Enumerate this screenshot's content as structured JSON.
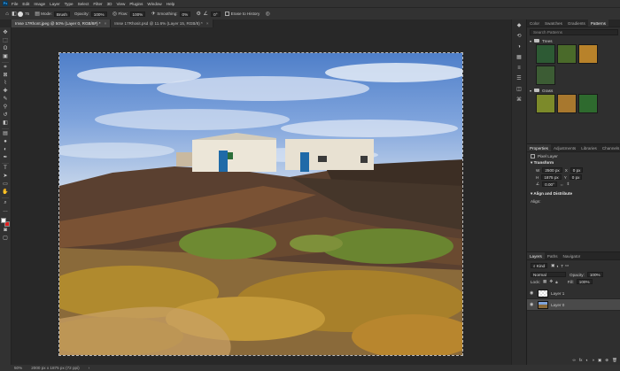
{
  "menubar": {
    "logo": "Ps",
    "items": [
      "File",
      "Edit",
      "Image",
      "Layer",
      "Type",
      "Select",
      "Filter",
      "3D",
      "View",
      "Plugins",
      "Window",
      "Help"
    ]
  },
  "options": {
    "mode_label": "Mode:",
    "mode_value": "Brush",
    "opacity_label": "Opacity:",
    "opacity_value": "100%",
    "flow_label": "Flow:",
    "flow_value": "100%",
    "smoothing_label": "Smoothing:",
    "smoothing_value": "0%",
    "angle_value": "0°",
    "erase_history": "Erase to History",
    "brush_size": "75"
  },
  "tabs": [
    {
      "label": "Imse 17Rhont.jpeg @ 50% (Layer 0, RGB/8#) *",
      "close": "×"
    },
    {
      "label": "Imse 17Rhosit.psd @ 11.6% (Layer 15, RGB/8) *",
      "close": "×"
    }
  ],
  "toolbar": {
    "tools": [
      {
        "name": "move-tool",
        "glyph": "✥"
      },
      {
        "name": "artboard-tool",
        "glyph": "⬚"
      },
      {
        "name": "lasso-tool",
        "glyph": "ʘ"
      },
      {
        "name": "object-select-tool",
        "glyph": "▣"
      },
      {
        "name": "crop-tool",
        "glyph": "⌗"
      },
      {
        "name": "frame-tool",
        "glyph": "⊠"
      },
      {
        "name": "eyedropper-tool",
        "glyph": "⌇"
      },
      {
        "name": "spot-healing-tool",
        "glyph": "✚"
      },
      {
        "name": "brush-tool",
        "glyph": "✎"
      },
      {
        "name": "clone-stamp-tool",
        "glyph": "⚲"
      },
      {
        "name": "history-brush-tool",
        "glyph": "↺"
      },
      {
        "name": "eraser-tool",
        "glyph": "◧"
      },
      {
        "name": "gradient-tool",
        "glyph": "▤"
      },
      {
        "name": "blur-tool",
        "glyph": "●"
      },
      {
        "name": "dodge-tool",
        "glyph": "◐"
      },
      {
        "name": "pen-tool",
        "glyph": "✒"
      },
      {
        "name": "type-tool",
        "glyph": "T"
      },
      {
        "name": "path-select-tool",
        "glyph": "➤"
      },
      {
        "name": "rectangle-tool",
        "glyph": "▭"
      },
      {
        "name": "hand-tool",
        "glyph": "✋"
      },
      {
        "name": "zoom-tool",
        "glyph": "⌕"
      },
      {
        "name": "more-tools",
        "glyph": "…"
      }
    ],
    "fg_color": "#ffffff",
    "bg_color": "#e01e1e"
  },
  "status": {
    "zoom": "50%",
    "dims": "2000 px x 1875 px (72 ppi)",
    "arrow": "›"
  },
  "iconstrip": [
    {
      "name": "learn-icon",
      "glyph": "◆"
    },
    {
      "name": "history-icon",
      "glyph": "⟲"
    },
    {
      "name": "color-icon",
      "glyph": "◑"
    },
    {
      "name": "swatches-icon",
      "glyph": "▦"
    },
    {
      "name": "properties-icon",
      "glyph": "≡"
    },
    {
      "name": "adjust-icon",
      "glyph": "☰"
    },
    {
      "name": "layers-icon",
      "glyph": "◫"
    },
    {
      "name": "paths-icon",
      "glyph": "⌘"
    }
  ],
  "patterns": {
    "tabs": [
      "Color",
      "Swatches",
      "Gradients",
      "Patterns"
    ],
    "search_placeholder": "Search Patterns",
    "groups": [
      {
        "name": "Trees",
        "colors": [
          "#2d5a34",
          "#4a6a2a",
          "#b8822a"
        ]
      },
      {
        "name": "Grass",
        "colors": [
          "#7c8a2a",
          "#a8782e",
          "#2e6a2e"
        ]
      }
    ],
    "extra_tree": "#3c5c34"
  },
  "properties": {
    "tabs": [
      "Properties",
      "Adjustments",
      "Libraries",
      "Channels"
    ],
    "pixel_layer": "Pixel Layer",
    "transform_title": "Transform",
    "w_label": "W",
    "w_value": "2500 px",
    "x_label": "X",
    "x_value": "0 px",
    "h_label": "H",
    "h_value": "1875 px",
    "y_label": "Y",
    "y_value": "0 px",
    "angle_value": "0.00°",
    "align_title": "Align and Distribute",
    "align_label": "Align:"
  },
  "layers": {
    "tabs": [
      "Layers",
      "Paths",
      "Navigator"
    ],
    "kind": "Kind",
    "blend": "Normal",
    "opacity_label": "Opacity:",
    "opacity": "100%",
    "lock_label": "Lock:",
    "fill_label": "Fill:",
    "fill": "100%",
    "items": [
      {
        "name": "Layer 1",
        "selected": false
      },
      {
        "name": "Layer 0",
        "selected": true
      }
    ],
    "footer_icons": [
      "∞",
      "fx",
      "◐",
      "◑",
      "▣",
      "⊕",
      "🗑"
    ]
  }
}
